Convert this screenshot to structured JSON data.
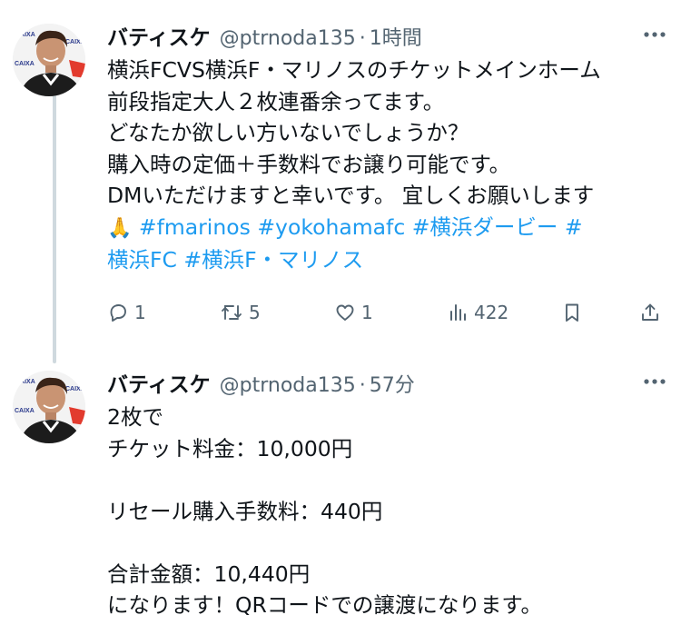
{
  "tweets": [
    {
      "display_name": "バティスケ",
      "handle": "@ptrnoda135",
      "separator": "·",
      "time": "1時間",
      "lines": [
        "横浜FCVS横浜F・マリノスのチケットメインホーム",
        "前段指定大人２枚連番余ってます。",
        "どなたか欲しい方いないでしょうか？",
        "購入時の定価＋手数料でお譲り可能です。",
        "DMいただけますと幸いです。 宜しくお願いします"
      ],
      "emoji": "🙏",
      "hashtags": [
        "#fmarinos",
        "#yokohamafc",
        "#横浜ダービー",
        "#"
      ],
      "hashtags_line2": [
        "横浜FC",
        "#横浜F・マリノス"
      ],
      "stats": {
        "replies": "1",
        "retweets": "5",
        "likes": "1",
        "views": "422"
      }
    },
    {
      "display_name": "バティスケ",
      "handle": "@ptrnoda135",
      "separator": "·",
      "time": "57分",
      "lines": [
        "2枚で",
        "チケット料金：10,000円",
        "",
        "リセール購入手数料：440円",
        "",
        "合計金額：10,440円",
        "になります！QRコードでの譲渡になります。"
      ]
    }
  ],
  "icons": {
    "more": "more-horizontal-icon",
    "reply": "reply-icon",
    "retweet": "retweet-icon",
    "like": "heart-icon",
    "views": "views-icon",
    "bookmark": "bookmark-icon",
    "share": "share-icon"
  },
  "colors": {
    "text": "#0f1419",
    "secondary": "#536471",
    "link": "#1d9bf0",
    "thread_line": "#cfd9de"
  }
}
